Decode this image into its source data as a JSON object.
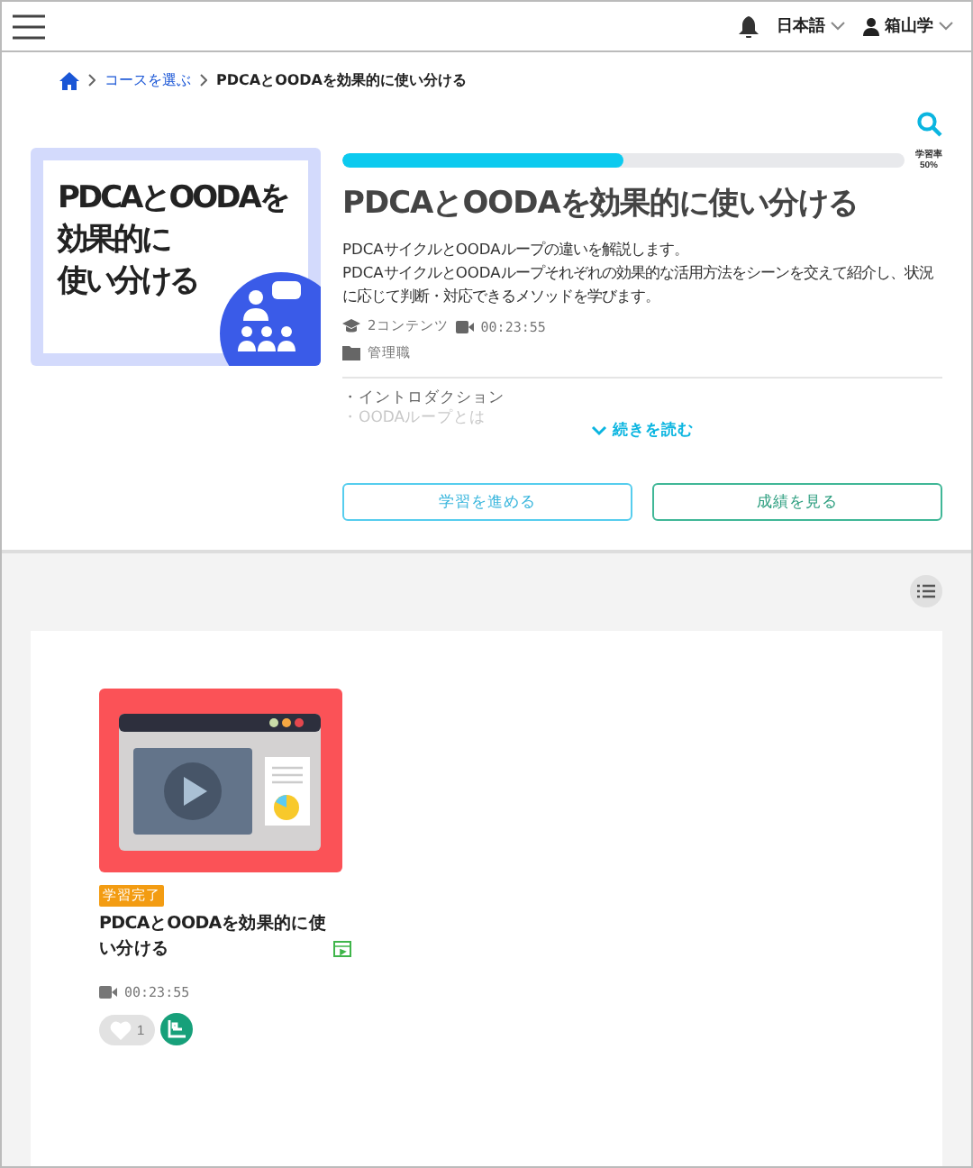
{
  "header": {
    "language": "日本語",
    "user": "箱山学"
  },
  "breadcrumb": [
    {
      "label": "コースを選ぶ",
      "link": true
    },
    {
      "label": "PDCAとOODAを効果的に使い分ける",
      "link": false
    }
  ],
  "course": {
    "thumbnail_lines": [
      "PDCAとOODAを",
      "効果的に",
      "使い分ける"
    ],
    "progress": {
      "label": "学習率",
      "reading": "50%",
      "level": 0.5
    },
    "title": "PDCAとOODAを効果的に使い分ける",
    "description": [
      "PDCAサイクルとOODAループの違いを解説します。",
      "PDCAサイクルとOODAループそれぞれの効果的な活用方法をシーンを交えて紹介し、状況に応じて判断・対応できるメソッドを学びます。"
    ],
    "contents": "2コンテンツ",
    "duration": "00:23:55",
    "category": "管理職",
    "outline": [
      "・イントロダクション",
      "・OODAループとは"
    ],
    "read_more": "続きを読む",
    "buttons": [
      {
        "label": "学習を進める",
        "kind": "primary"
      },
      {
        "label": "成績を見る",
        "kind": "secondary"
      }
    ]
  },
  "contents": [
    {
      "badge": "学習完了",
      "title": "PDCAとOODAを効果的に使い分ける",
      "duration": "00:23:55",
      "likes": "1"
    }
  ]
}
